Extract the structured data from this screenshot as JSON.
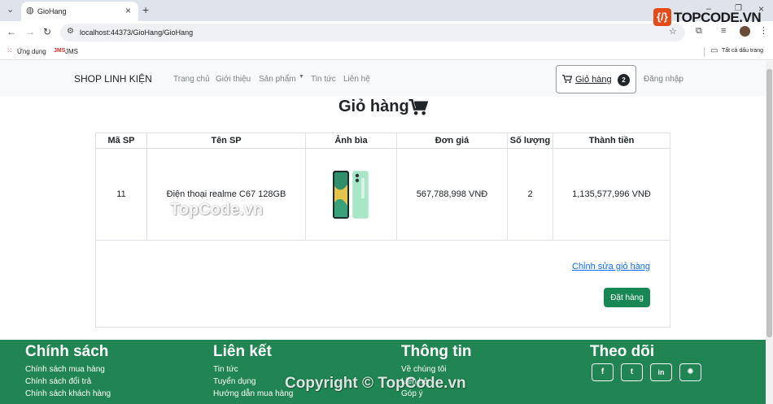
{
  "browser": {
    "tab_title": "GioHang",
    "url": "localhost:44373/GioHang/GioHang",
    "bookmarks": [
      "Ứng dụng",
      "JMS"
    ],
    "all_bookmarks": "Tất cả dấu trang"
  },
  "navbar": {
    "brand": "SHOP LINH KIỆN",
    "links": [
      "Trang chủ",
      "Giới thiệu",
      "Sản phẩm",
      "Tin tức",
      "Liên hệ"
    ],
    "cart_label": "Giỏ hàng",
    "cart_count": "2",
    "login": "Đăng nhập"
  },
  "cart": {
    "title": "Giỏ hàng",
    "columns": [
      "Mã SP",
      "Tên SP",
      "Ảnh bìa",
      "Đơn giá",
      "Số lượng",
      "Thành tiền"
    ],
    "rows": [
      {
        "id": "11",
        "name": "Điện thoại realme C67 128GB",
        "price": "567,788,998 VNĐ",
        "qty": "2",
        "total": "1,135,577,996 VNĐ"
      }
    ],
    "edit_link": "Chỉnh sửa giỏ hàng",
    "order_button": "Đặt hàng"
  },
  "footer": {
    "columns": [
      {
        "heading": "Chính sách",
        "links": [
          "Chính sách mua hàng",
          "Chính sách đổi trả",
          "Chính sách khách hàng"
        ]
      },
      {
        "heading": "Liên kết",
        "links": [
          "Tin tức",
          "Tuyển dụng",
          "Hướng dẫn mua hàng"
        ]
      },
      {
        "heading": "Thông tin",
        "links": [
          "Về chúng tôi",
          "Liên hệ",
          "Góp ý"
        ]
      },
      {
        "heading": "Theo dõi",
        "social": [
          "f",
          "t",
          "in",
          "✺"
        ]
      }
    ]
  },
  "watermarks": [
    "TOPCODE.VN",
    "TopCode.vn",
    "Copyright © TopCode.vn"
  ],
  "colors": {
    "footer": "#208552",
    "order_button": "#198754",
    "link": "#0d6efd",
    "badge": "#212529"
  }
}
